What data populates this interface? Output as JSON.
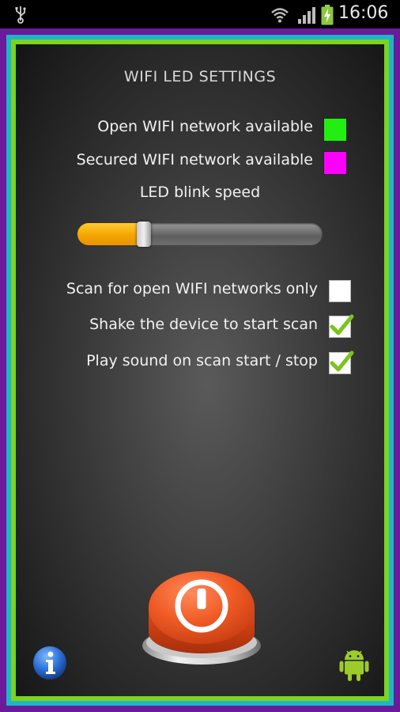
{
  "status_bar": {
    "time": "16:06",
    "icons": [
      "usb-icon",
      "wifi-icon",
      "signal-icon",
      "battery-charging-icon"
    ]
  },
  "panel": {
    "title": "WIFI LED SETTINGS",
    "open_network": {
      "label": "Open WIFI network available",
      "color": "#22ee11"
    },
    "secured_network": {
      "label": "Secured WIFI network available",
      "color": "#ff00ff"
    },
    "speed": {
      "label": "LED blink speed",
      "value": 0.27
    },
    "options": [
      {
        "label": "Scan for open WIFI networks only",
        "checked": false
      },
      {
        "label": "Shake the device to start scan",
        "checked": true
      },
      {
        "label": "Play sound on scan start / stop",
        "checked": true
      }
    ]
  },
  "bottom": {
    "power_button_icon": "power-icon",
    "info_icon": "info-icon",
    "android_icon": "android-icon"
  },
  "colors": {
    "frame_purple": "#6a1a9a",
    "frame_teal": "#1cb6c4",
    "frame_green": "#7dd321",
    "slider_fill": "#f5a500",
    "power_red": "#e8441c",
    "checkmark": "#7ac41c"
  }
}
